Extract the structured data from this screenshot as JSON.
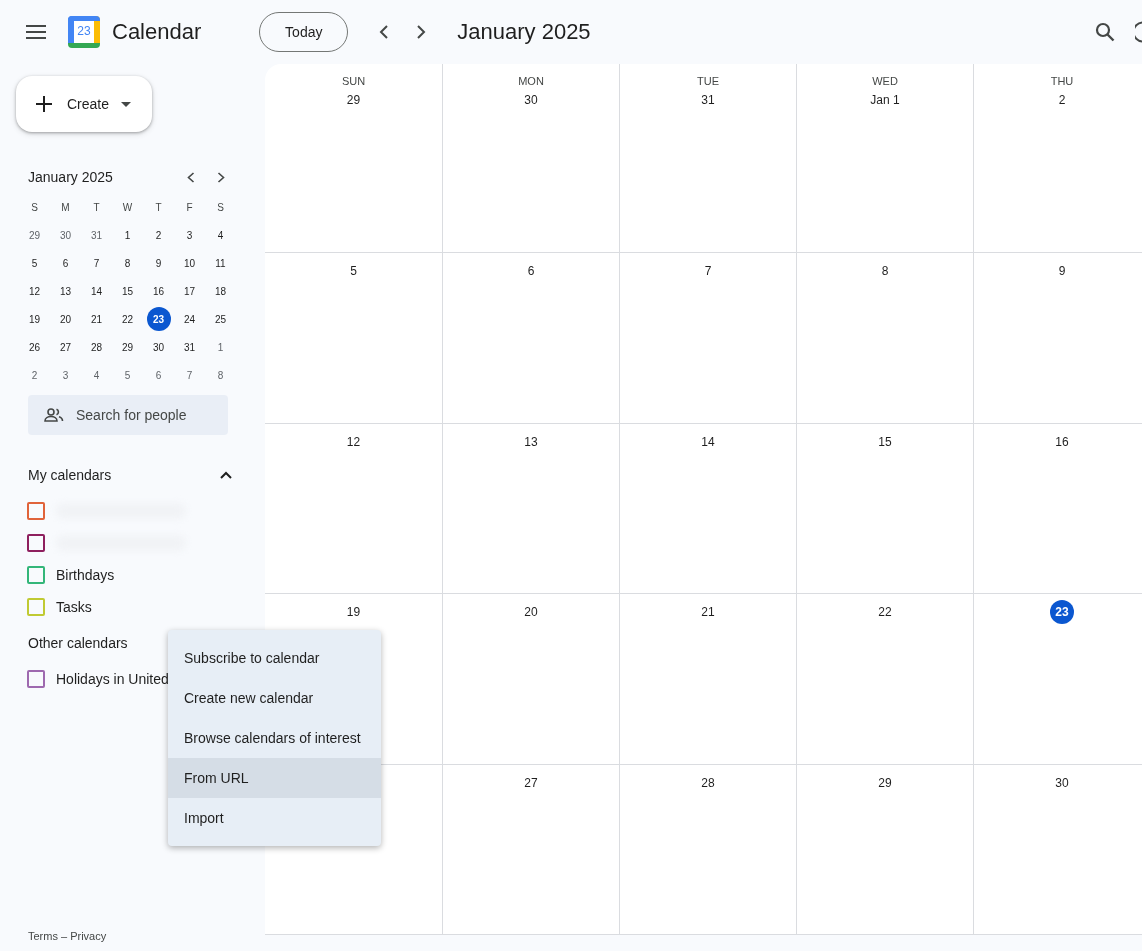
{
  "header": {
    "app_name": "Calendar",
    "logo_day": "23",
    "today_button": "Today",
    "title": "January 2025"
  },
  "create_button": "Create",
  "mini_calendar": {
    "title": "January 2025",
    "weekdays": [
      "S",
      "M",
      "T",
      "W",
      "T",
      "F",
      "S"
    ],
    "weeks": [
      [
        {
          "label": "29",
          "muted": true,
          "selected": false
        },
        {
          "label": "30",
          "muted": true,
          "selected": false
        },
        {
          "label": "31",
          "muted": true,
          "selected": false
        },
        {
          "label": "1",
          "muted": false,
          "selected": false
        },
        {
          "label": "2",
          "muted": false,
          "selected": false
        },
        {
          "label": "3",
          "muted": false,
          "selected": false
        },
        {
          "label": "4",
          "muted": false,
          "selected": false
        }
      ],
      [
        {
          "label": "5",
          "muted": false,
          "selected": false
        },
        {
          "label": "6",
          "muted": false,
          "selected": false
        },
        {
          "label": "7",
          "muted": false,
          "selected": false
        },
        {
          "label": "8",
          "muted": false,
          "selected": false
        },
        {
          "label": "9",
          "muted": false,
          "selected": false
        },
        {
          "label": "10",
          "muted": false,
          "selected": false
        },
        {
          "label": "11",
          "muted": false,
          "selected": false
        }
      ],
      [
        {
          "label": "12",
          "muted": false,
          "selected": false
        },
        {
          "label": "13",
          "muted": false,
          "selected": false
        },
        {
          "label": "14",
          "muted": false,
          "selected": false
        },
        {
          "label": "15",
          "muted": false,
          "selected": false
        },
        {
          "label": "16",
          "muted": false,
          "selected": false
        },
        {
          "label": "17",
          "muted": false,
          "selected": false
        },
        {
          "label": "18",
          "muted": false,
          "selected": false
        }
      ],
      [
        {
          "label": "19",
          "muted": false,
          "selected": false
        },
        {
          "label": "20",
          "muted": false,
          "selected": false
        },
        {
          "label": "21",
          "muted": false,
          "selected": false
        },
        {
          "label": "22",
          "muted": false,
          "selected": false
        },
        {
          "label": "23",
          "muted": false,
          "selected": true
        },
        {
          "label": "24",
          "muted": false,
          "selected": false
        },
        {
          "label": "25",
          "muted": false,
          "selected": false
        }
      ],
      [
        {
          "label": "26",
          "muted": false,
          "selected": false
        },
        {
          "label": "27",
          "muted": false,
          "selected": false
        },
        {
          "label": "28",
          "muted": false,
          "selected": false
        },
        {
          "label": "29",
          "muted": false,
          "selected": false
        },
        {
          "label": "30",
          "muted": false,
          "selected": false
        },
        {
          "label": "31",
          "muted": false,
          "selected": false
        },
        {
          "label": "1",
          "muted": true,
          "selected": false
        }
      ],
      [
        {
          "label": "2",
          "muted": true,
          "selected": false
        },
        {
          "label": "3",
          "muted": true,
          "selected": false
        },
        {
          "label": "4",
          "muted": true,
          "selected": false
        },
        {
          "label": "5",
          "muted": true,
          "selected": false
        },
        {
          "label": "6",
          "muted": true,
          "selected": false
        },
        {
          "label": "7",
          "muted": true,
          "selected": false
        },
        {
          "label": "8",
          "muted": true,
          "selected": false
        }
      ]
    ]
  },
  "search_people": {
    "placeholder": "Search for people"
  },
  "my_calendars": {
    "title": "My calendars",
    "expanded": true,
    "items": [
      {
        "kind": "redacted",
        "color": "#e0633a",
        "checked": false
      },
      {
        "kind": "redacted",
        "color": "#8e1f5e",
        "checked": false
      },
      {
        "kind": "named",
        "label": "Birthdays",
        "color": "#33b679",
        "checked": false
      },
      {
        "kind": "named",
        "label": "Tasks",
        "color": "#c0ca33",
        "checked": false
      }
    ]
  },
  "other_calendars": {
    "title": "Other calendars",
    "items": [
      {
        "kind": "named",
        "label": "Holidays in United",
        "color": "#9e69af",
        "checked": false
      }
    ]
  },
  "menu": {
    "items": [
      {
        "label": "Subscribe to calendar",
        "highlighted": false
      },
      {
        "label": "Create new calendar",
        "highlighted": false
      },
      {
        "label": "Browse calendars of interest",
        "highlighted": false
      },
      {
        "label": "From URL",
        "highlighted": true
      },
      {
        "label": "Import",
        "highlighted": false
      }
    ]
  },
  "footer": "Terms – Privacy",
  "month_grid": {
    "weekdays": [
      "SUN",
      "MON",
      "TUE",
      "WED",
      "THU"
    ],
    "weeks": [
      [
        {
          "label": "29",
          "today": false
        },
        {
          "label": "30",
          "today": false
        },
        {
          "label": "31",
          "today": false
        },
        {
          "label": "Jan 1",
          "today": false
        },
        {
          "label": "2",
          "today": false
        }
      ],
      [
        {
          "label": "5",
          "today": false
        },
        {
          "label": "6",
          "today": false
        },
        {
          "label": "7",
          "today": false
        },
        {
          "label": "8",
          "today": false
        },
        {
          "label": "9",
          "today": false
        }
      ],
      [
        {
          "label": "12",
          "today": false
        },
        {
          "label": "13",
          "today": false
        },
        {
          "label": "14",
          "today": false
        },
        {
          "label": "15",
          "today": false
        },
        {
          "label": "16",
          "today": false
        }
      ],
      [
        {
          "label": "19",
          "today": false
        },
        {
          "label": "20",
          "today": false
        },
        {
          "label": "21",
          "today": false
        },
        {
          "label": "22",
          "today": false
        },
        {
          "label": "23",
          "today": true
        }
      ],
      [
        {
          "label": "27",
          "today": false
        },
        {
          "label": "28",
          "today": false
        },
        {
          "label": "29",
          "today": false
        },
        {
          "label": "30",
          "today": false
        }
      ]
    ]
  }
}
